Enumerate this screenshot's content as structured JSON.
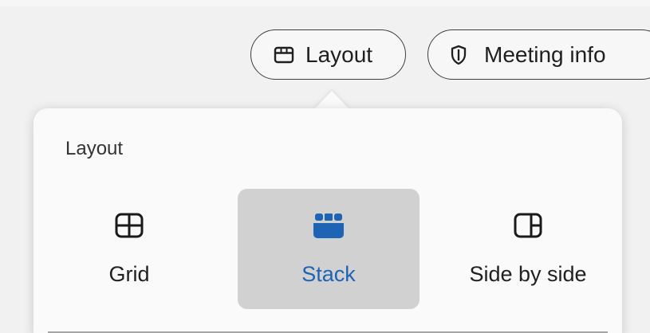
{
  "toolbar": {
    "layout_label": "Layout",
    "meeting_info_label": "Meeting info"
  },
  "popover": {
    "title": "Layout",
    "options": [
      {
        "label": "Grid",
        "icon": "grid-icon",
        "selected": false
      },
      {
        "label": "Stack",
        "icon": "stack-icon",
        "selected": true
      },
      {
        "label": "Side by side",
        "icon": "side-by-side-icon",
        "selected": false
      }
    ]
  },
  "colors": {
    "accent": "#1e64b4",
    "selected_bg": "#d1d1d1",
    "background": "#f1f1f1"
  }
}
